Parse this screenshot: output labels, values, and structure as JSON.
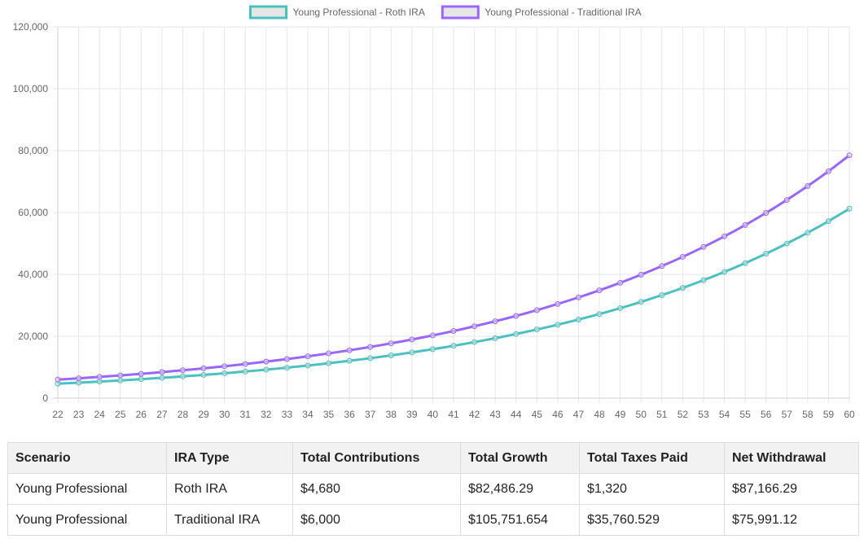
{
  "chart_data": {
    "type": "line",
    "x": [
      22,
      23,
      24,
      25,
      26,
      27,
      28,
      29,
      30,
      31,
      32,
      33,
      34,
      35,
      36,
      37,
      38,
      39,
      40,
      41,
      42,
      43,
      44,
      45,
      46,
      47,
      48,
      49,
      50,
      51,
      52,
      53,
      54,
      55,
      56,
      57,
      58,
      59,
      60
    ],
    "ylim": [
      0,
      120000
    ],
    "yticks": [
      0,
      20000,
      40000,
      60000,
      80000,
      100000,
      120000
    ],
    "ytick_labels": [
      "0",
      "20,000",
      "40,000",
      "60,000",
      "80,000",
      "100,000",
      "120,000"
    ],
    "grid": true,
    "legend_position": "top-center",
    "series": [
      {
        "name": "Young Professional - Roth IRA",
        "color": "#4bc0c0",
        "values": [
          4680,
          5008,
          5358,
          5733,
          6135,
          6564,
          7024,
          7515,
          8041,
          8604,
          9206,
          9851,
          10540,
          11278,
          12068,
          12912,
          13816,
          14783,
          15818,
          16925,
          18110,
          19378,
          20734,
          22186,
          23739,
          25400,
          27178,
          29081,
          31116,
          33294,
          35625,
          38119,
          40787,
          43642,
          46697,
          49966,
          53464,
          57206,
          61210
        ]
      },
      {
        "name": "Young Professional - Traditional IRA",
        "color": "#9966ff",
        "values": [
          6000,
          6420,
          6869,
          7350,
          7865,
          8415,
          9004,
          9635,
          10309,
          11031,
          11803,
          12629,
          13513,
          14459,
          15471,
          16554,
          17713,
          18953,
          20280,
          21699,
          23218,
          24843,
          26582,
          28443,
          30434,
          32565,
          34844,
          37283,
          39893,
          42686,
          45674,
          48871,
          52292,
          55952,
          59869,
          64060,
          68544,
          73342,
          78476
        ]
      }
    ]
  },
  "table": {
    "headers": [
      "Scenario",
      "IRA Type",
      "Total Contributions",
      "Total Growth",
      "Total Taxes Paid",
      "Net Withdrawal"
    ],
    "rows": [
      [
        "Young Professional",
        "Roth IRA",
        "$4,680",
        "$82,486.29",
        "$1,320",
        "$87,166.29"
      ],
      [
        "Young Professional",
        "Traditional IRA",
        "$6,000",
        "$105,751.654",
        "$35,760.529",
        "$75,991.12"
      ]
    ]
  }
}
